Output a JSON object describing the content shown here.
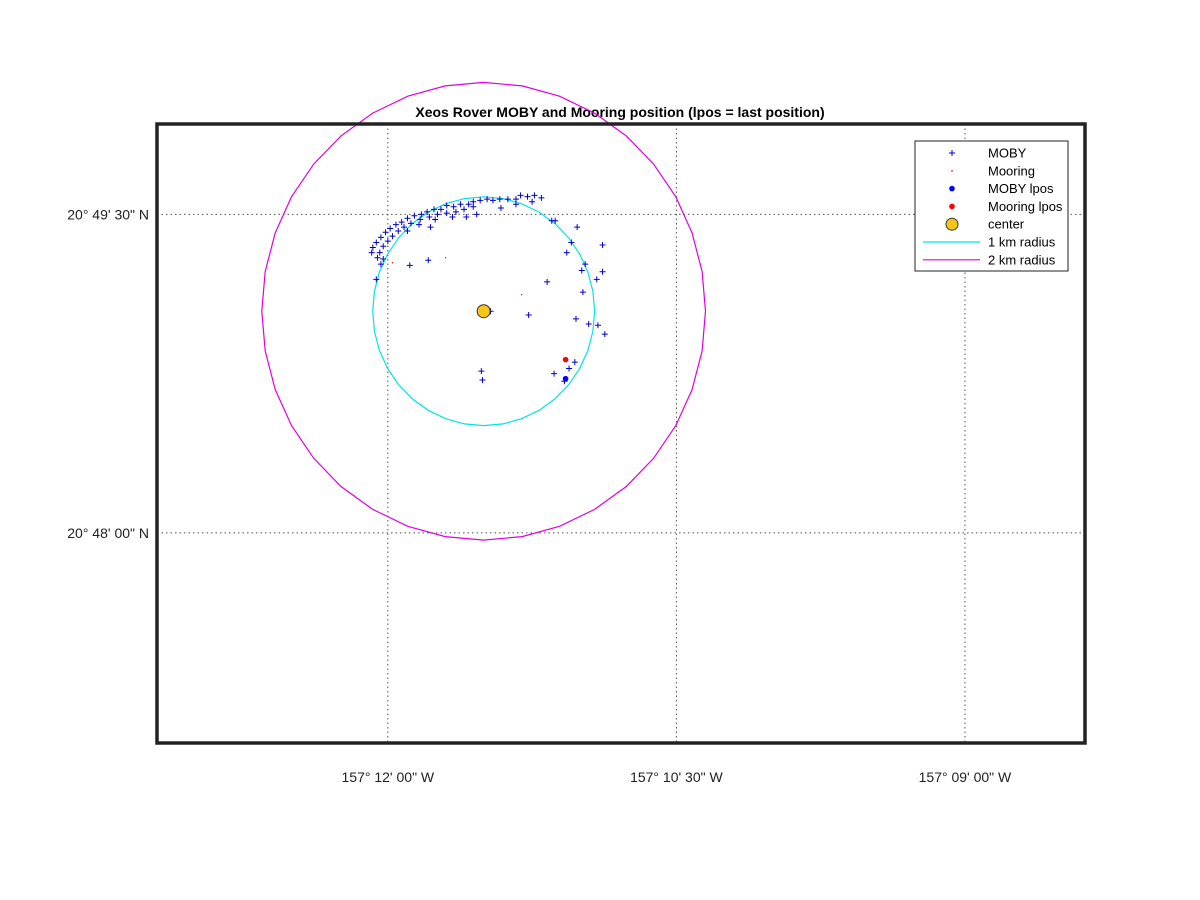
{
  "chart_data": {
    "type": "scatter",
    "title": "Xeos Rover MOBY and Mooring position (lpos = last position)",
    "xlabel": "",
    "ylabel": "",
    "x_units": "decimal degrees longitude",
    "y_units": "decimal degrees latitude",
    "xlim": [
      -157.22,
      -157.1396
    ],
    "ylim": [
      20.7835,
      20.8321
    ],
    "grid": true,
    "grid_style": "dotted",
    "legend_location": "top-right",
    "x_ticks": [
      {
        "value": -157.2,
        "label": "157° 12' 00\" W"
      },
      {
        "value": -157.175,
        "label": "157° 10' 30\" W"
      },
      {
        "value": -157.15,
        "label": "157° 09' 00\" W"
      }
    ],
    "y_ticks": [
      {
        "value": 20.825,
        "label": "20° 49' 30\" N"
      },
      {
        "value": 20.8,
        "label": "20° 48' 00\" N"
      }
    ],
    "center": {
      "lon": -157.1917,
      "lat": 20.8174
    },
    "circles": [
      {
        "name": "1 km radius",
        "radius_m": 1000,
        "color": "#00e5e5"
      },
      {
        "name": "2 km radius",
        "radius_m": 2000,
        "color": "#e000e0"
      }
    ],
    "series": [
      {
        "name": "MOBY",
        "marker": "+",
        "color": "#0000cc",
        "points": [
          [
            -157.1885,
            20.8265
          ],
          [
            -157.1879,
            20.8264
          ],
          [
            -157.1873,
            20.8265
          ],
          [
            -157.1867,
            20.8263
          ],
          [
            -157.1875,
            20.826
          ],
          [
            -157.1889,
            20.8262
          ],
          [
            -157.1896,
            20.8262
          ],
          [
            -157.1903,
            20.8262
          ],
          [
            -157.1909,
            20.8261
          ],
          [
            -157.1914,
            20.8262
          ],
          [
            -157.192,
            20.8261
          ],
          [
            -157.1926,
            20.826
          ],
          [
            -157.193,
            20.8258
          ],
          [
            -157.1937,
            20.8258
          ],
          [
            -157.1943,
            20.8256
          ],
          [
            -157.1949,
            20.8257
          ],
          [
            -157.1954,
            20.8254
          ],
          [
            -157.196,
            20.8254
          ],
          [
            -157.1966,
            20.8252
          ],
          [
            -157.1971,
            20.825
          ],
          [
            -157.1977,
            20.8249
          ],
          [
            -157.1983,
            20.8247
          ],
          [
            -157.1988,
            20.8244
          ],
          [
            -157.1993,
            20.8242
          ],
          [
            -157.1998,
            20.8239
          ],
          [
            -157.2002,
            20.8236
          ],
          [
            -157.2006,
            20.8232
          ],
          [
            -157.201,
            20.8228
          ],
          [
            -157.2013,
            20.8224
          ],
          [
            -157.2014,
            20.822
          ],
          [
            -157.1926,
            20.8256
          ],
          [
            -157.1934,
            20.8254
          ],
          [
            -157.1941,
            20.8252
          ],
          [
            -157.1949,
            20.8251
          ],
          [
            -157.1957,
            20.825
          ],
          [
            -157.1964,
            20.8248
          ],
          [
            -157.1972,
            20.8246
          ],
          [
            -157.198,
            20.8243
          ],
          [
            -157.1986,
            20.824
          ],
          [
            -157.1991,
            20.8237
          ],
          [
            -157.1996,
            20.8233
          ],
          [
            -157.2,
            20.8229
          ],
          [
            -157.2004,
            20.8225
          ],
          [
            -157.2007,
            20.822
          ],
          [
            -157.2009,
            20.8216
          ],
          [
            -157.1973,
            20.8242
          ],
          [
            -157.1959,
            20.8246
          ],
          [
            -157.1944,
            20.8248
          ],
          [
            -157.1902,
            20.8255
          ],
          [
            -157.1889,
            20.8258
          ],
          [
            -157.1983,
            20.8237
          ],
          [
            -157.1963,
            20.824
          ],
          [
            -157.2004,
            20.8215
          ],
          [
            -157.2006,
            20.8211
          ],
          [
            -157.201,
            20.8199
          ],
          [
            -157.1981,
            20.821
          ],
          [
            -157.1965,
            20.8214
          ],
          [
            -157.1923,
            20.825
          ],
          [
            -157.1932,
            20.8248
          ],
          [
            -157.1858,
            20.8245
          ],
          [
            -157.1855,
            20.8245
          ],
          [
            -157.1836,
            20.824
          ],
          [
            -157.1845,
            20.822
          ],
          [
            -157.1841,
            20.8228
          ],
          [
            -157.1814,
            20.8226
          ],
          [
            -157.1829,
            20.8211
          ],
          [
            -157.1832,
            20.8206
          ],
          [
            -157.1814,
            20.8205
          ],
          [
            -157.1831,
            20.8189
          ],
          [
            -157.1862,
            20.8197
          ],
          [
            -157.1911,
            20.8174
          ],
          [
            -157.1878,
            20.8171
          ],
          [
            -157.1826,
            20.8164
          ],
          [
            -157.1818,
            20.8163
          ],
          [
            -157.1812,
            20.8156
          ],
          [
            -157.1838,
            20.8134
          ],
          [
            -157.1843,
            20.8129
          ],
          [
            -157.1856,
            20.8125
          ],
          [
            -157.1919,
            20.8127
          ],
          [
            -157.1918,
            20.812
          ],
          [
            -157.1847,
            20.8119
          ],
          [
            -157.1819,
            20.8199
          ],
          [
            -157.1837,
            20.8168
          ]
        ]
      },
      {
        "name": "Mooring",
        "marker": ".",
        "color": "#e00000",
        "points": [
          [
            -157.1884,
            20.8187
          ],
          [
            -157.195,
            20.8216
          ],
          [
            -157.1996,
            20.8212
          ]
        ]
      },
      {
        "name": "MOBY lpos",
        "marker": "o",
        "color": "#0000ff",
        "points": [
          [
            -157.1846,
            20.8121
          ]
        ]
      },
      {
        "name": "Mooring lpos",
        "marker": "o",
        "color": "#ff0000",
        "points": [
          [
            -157.1846,
            20.8136
          ]
        ]
      },
      {
        "name": "center",
        "marker": "o",
        "color": "#f5c518",
        "points": [
          [
            -157.1917,
            20.8174
          ]
        ]
      }
    ],
    "legend": [
      {
        "label": "MOBY",
        "kind": "plus",
        "color": "#0000cc"
      },
      {
        "label": "Mooring",
        "kind": "dot",
        "color": "#e00000"
      },
      {
        "label": "MOBY lpos",
        "kind": "filled",
        "color": "#0000ff"
      },
      {
        "label": "Mooring lpos",
        "kind": "filled",
        "color": "#ff0000"
      },
      {
        "label": "center",
        "kind": "big",
        "color": "#f5c518"
      },
      {
        "label": "1 km radius",
        "kind": "line",
        "color": "#00e5e5"
      },
      {
        "label": "2 km radius",
        "kind": "line",
        "color": "#e000e0"
      }
    ]
  }
}
